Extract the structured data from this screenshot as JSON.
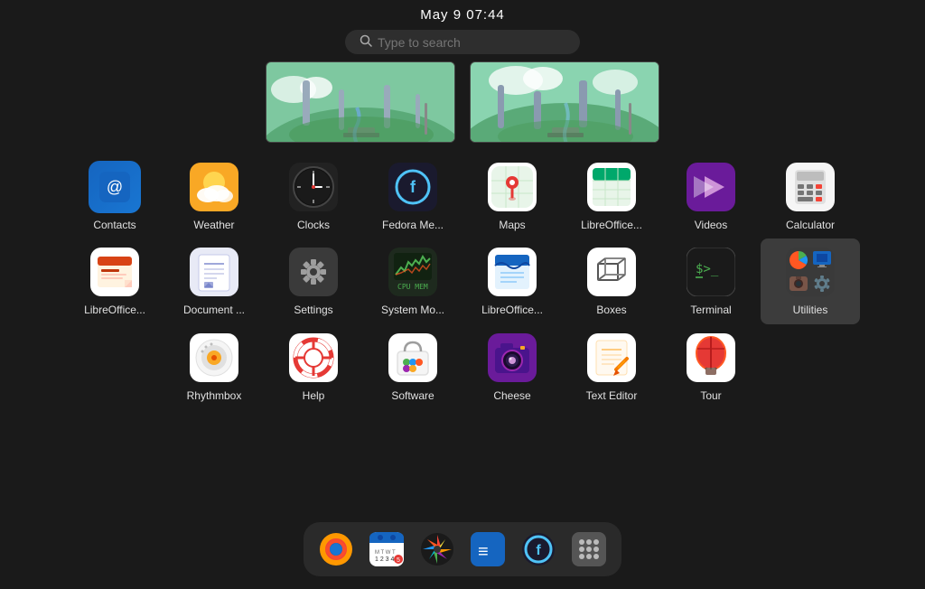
{
  "header": {
    "datetime": "May 9  07:44",
    "search_placeholder": "Type to search"
  },
  "apps_row1": [
    {
      "id": "contacts",
      "label": "Contacts",
      "icon_class": "icon-contacts",
      "icon_symbol": "@"
    },
    {
      "id": "weather",
      "label": "Weather",
      "icon_class": "icon-weather",
      "icon_symbol": "☀"
    },
    {
      "id": "clocks",
      "label": "Clocks",
      "icon_class": "icon-clocks",
      "icon_symbol": "⏰"
    },
    {
      "id": "fedora-media",
      "label": "Fedora Me...",
      "icon_class": "icon-fedora",
      "icon_symbol": "f"
    },
    {
      "id": "maps",
      "label": "Maps",
      "icon_class": "icon-maps",
      "icon_symbol": "📍"
    },
    {
      "id": "libreoffice-calc",
      "label": "LibreOffice...",
      "icon_class": "icon-libreoffice-calc",
      "icon_symbol": "📊"
    },
    {
      "id": "videos",
      "label": "Videos",
      "icon_class": "icon-videos",
      "icon_symbol": "▶"
    },
    {
      "id": "calculator",
      "label": "Calculator",
      "icon_class": "icon-calculator",
      "icon_symbol": "🖩"
    }
  ],
  "apps_row2": [
    {
      "id": "libreoffice-impress",
      "label": "LibreOffice...",
      "icon_class": "icon-libreoffice-impress",
      "icon_symbol": "📋"
    },
    {
      "id": "document-viewer",
      "label": "Document ...",
      "icon_class": "icon-document",
      "icon_symbol": "📄"
    },
    {
      "id": "settings",
      "label": "Settings",
      "icon_class": "icon-settings",
      "icon_symbol": "⚙"
    },
    {
      "id": "system-monitor",
      "label": "System Mo...",
      "icon_class": "icon-system-monitor",
      "icon_symbol": "📈"
    },
    {
      "id": "libreoffice-writer",
      "label": "LibreOffice...",
      "icon_class": "icon-libreoffice-writer",
      "icon_symbol": "📝"
    },
    {
      "id": "boxes",
      "label": "Boxes",
      "icon_class": "icon-boxes",
      "icon_symbol": "⬡"
    },
    {
      "id": "terminal",
      "label": "Terminal",
      "icon_class": "icon-terminal",
      "icon_symbol": ">_"
    },
    {
      "id": "utilities",
      "label": "Utilities",
      "icon_class": "icon-utilities",
      "icon_symbol": "🛠",
      "active": true
    }
  ],
  "apps_row3": [
    {
      "id": "rhythmbox",
      "label": "Rhythmbox",
      "icon_class": "icon-rhythmbox",
      "icon_symbol": "🎵"
    },
    {
      "id": "help",
      "label": "Help",
      "icon_class": "icon-help",
      "icon_symbol": "⊕"
    },
    {
      "id": "software",
      "label": "Software",
      "icon_class": "icon-software",
      "icon_symbol": "🛍"
    },
    {
      "id": "cheese",
      "label": "Cheese",
      "icon_class": "icon-cheese",
      "icon_symbol": "🧀"
    },
    {
      "id": "text-editor",
      "label": "Text Editor",
      "icon_class": "icon-text-editor",
      "icon_symbol": "✏"
    },
    {
      "id": "tour",
      "label": "Tour",
      "icon_class": "icon-tour",
      "icon_symbol": "🎈"
    }
  ],
  "taskbar": {
    "items": [
      {
        "id": "firefox",
        "label": "Firefox",
        "icon": "🦊"
      },
      {
        "id": "calendar",
        "label": "Calendar",
        "icon": "📅"
      },
      {
        "id": "colorsync",
        "label": "Color Sync",
        "icon": "🎨"
      },
      {
        "id": "blueman",
        "label": "Blueman",
        "icon": "≡"
      },
      {
        "id": "fedora",
        "label": "Fedora",
        "icon": "f"
      },
      {
        "id": "apps-grid",
        "label": "Show Apps",
        "icon": "⋯"
      }
    ]
  }
}
